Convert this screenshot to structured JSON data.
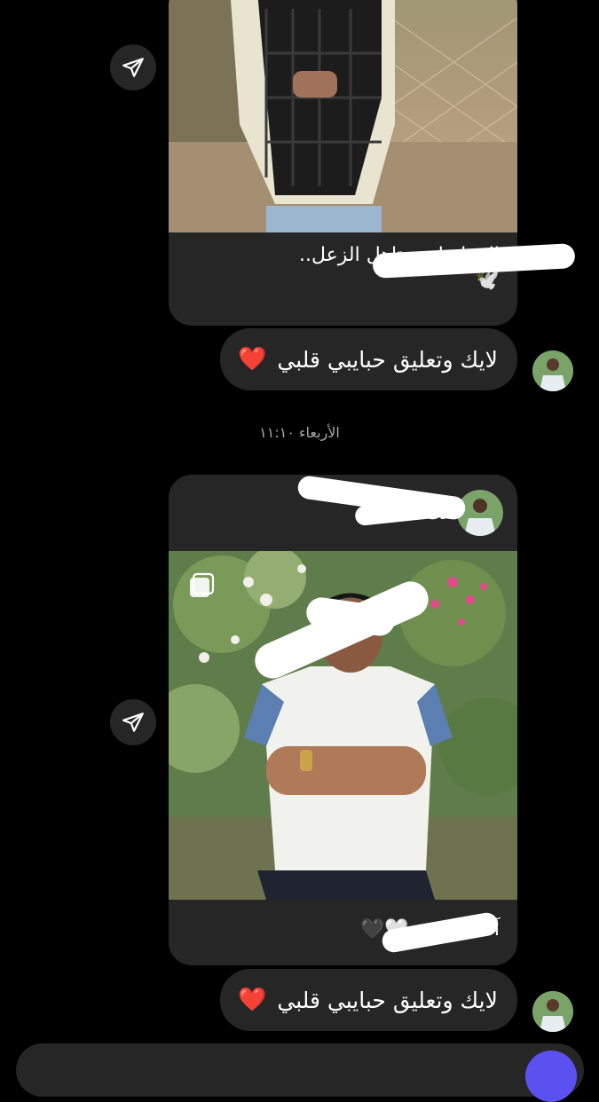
{
  "post1": {
    "caption_line": "الدنيا ما بتستاهل الزعل..",
    "caption_emoji": "🕊️"
  },
  "reply1": {
    "text": "لايك وتعليق حبايبي قلبي",
    "emoji": "❤️"
  },
  "timestamp": "الأربعاء ١١:١٠",
  "post2": {
    "username": "bel",
    "caption_text": "آلمـزيـےون",
    "caption_emojis": "🤍🖤"
  },
  "reply2": {
    "text": "لايك وتعليق حبايبي قلبي",
    "emoji": "❤️"
  },
  "icons": {
    "share": "paper-plane-icon",
    "heart": "red-heart-icon",
    "carousel": "multiple-photos-icon"
  },
  "colors": {
    "background": "#000000",
    "bubble": "#262626",
    "send_accent": "#5b51f0"
  }
}
